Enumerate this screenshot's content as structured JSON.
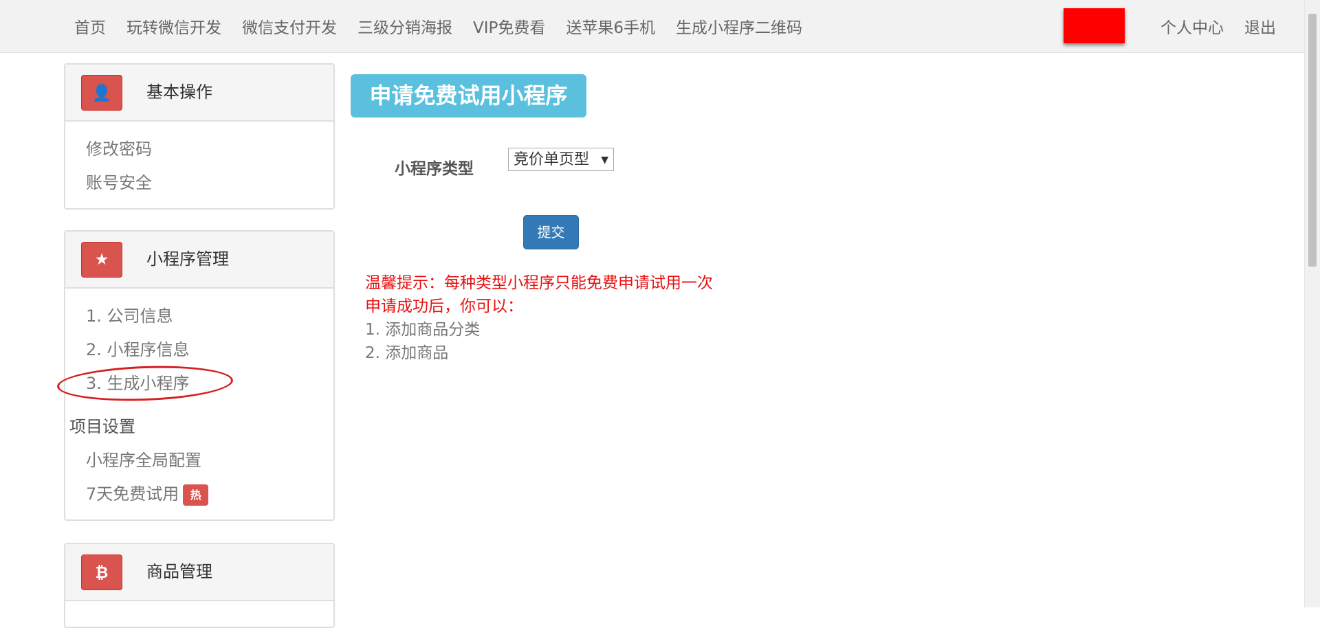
{
  "navbar": {
    "items": [
      "首页",
      "玩转微信开发",
      "微信支付开发",
      "三级分销海报",
      "VIP免费看",
      "送苹果6手机",
      "生成小程序二维码"
    ],
    "personal_center": "个人中心",
    "logout": "退出"
  },
  "sidebar": {
    "basic": {
      "icon": "user-icon",
      "icon_glyph": "👤",
      "title": "基本操作",
      "links": [
        "修改密码",
        "账号安全"
      ]
    },
    "miniprogram": {
      "icon": "star-icon",
      "icon_glyph": "★",
      "title": "小程序管理",
      "links": [
        "1. 公司信息",
        "2. 小程序信息",
        "3. 生成小程序"
      ],
      "project_settings_label": "项目设置",
      "settings_links": [
        "小程序全局配置",
        "7天免费试用"
      ],
      "hot_badge": "热"
    },
    "goods": {
      "icon": "bitcoin-icon",
      "icon_glyph": "₿",
      "title": "商品管理"
    }
  },
  "main": {
    "page_title": "申请免费试用小程序",
    "form": {
      "type_label": "小程序类型",
      "type_selected": "竞价单页型",
      "submit_label": "提交"
    },
    "tips": {
      "line1": "温馨提示：每种类型小程序只能免费申请试用一次",
      "line2": "申请成功后，你可以：",
      "line3": "1. 添加商品分类",
      "line4": "2. 添加商品"
    }
  },
  "colors": {
    "accent_red": "#d9534f",
    "title_blue": "#5bc0de",
    "button_blue": "#337ab7",
    "tip_red": "#e81010"
  }
}
